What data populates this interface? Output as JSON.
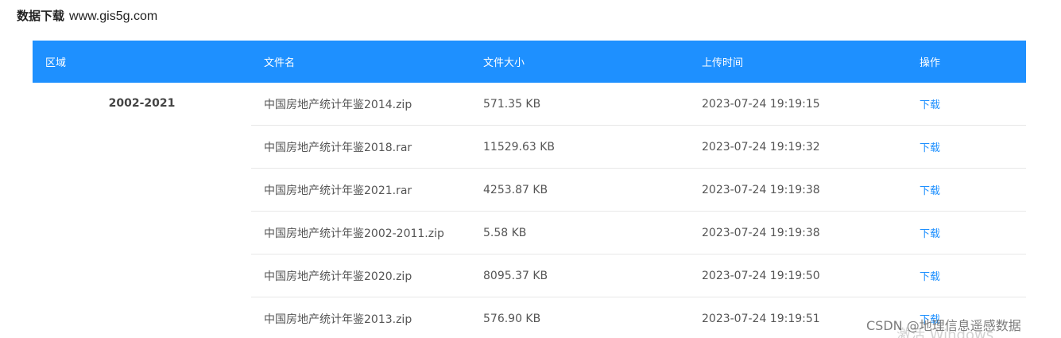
{
  "header": {
    "title": "数据下载",
    "site": "www.gis5g.com"
  },
  "table": {
    "columns": [
      "区域",
      "文件名",
      "文件大小",
      "上传时间",
      "操作"
    ],
    "region": "2002-2021",
    "rows": [
      {
        "name": "中国房地产统计年鉴2014.zip",
        "size": "571.35 KB",
        "time": "2023-07-24 19:19:15",
        "action": "下载"
      },
      {
        "name": "中国房地产统计年鉴2018.rar",
        "size": "11529.63 KB",
        "time": "2023-07-24 19:19:32",
        "action": "下载"
      },
      {
        "name": "中国房地产统计年鉴2021.rar",
        "size": "4253.87 KB",
        "time": "2023-07-24 19:19:38",
        "action": "下载"
      },
      {
        "name": "中国房地产统计年鉴2002-2011.zip",
        "size": "5.58 KB",
        "time": "2023-07-24 19:19:38",
        "action": "下载"
      },
      {
        "name": "中国房地产统计年鉴2020.zip",
        "size": "8095.37 KB",
        "time": "2023-07-24 19:19:50",
        "action": "下载"
      },
      {
        "name": "中国房地产统计年鉴2013.zip",
        "size": "576.90 KB",
        "time": "2023-07-24 19:19:51",
        "action": "下载"
      }
    ]
  },
  "watermark": {
    "csdn": "CSDN @地理信息遥感数据",
    "os": "激活 Windows"
  },
  "colors": {
    "header_bg": "#1e90ff",
    "link": "#1e90ff",
    "row_border": "#e8e8e8"
  }
}
